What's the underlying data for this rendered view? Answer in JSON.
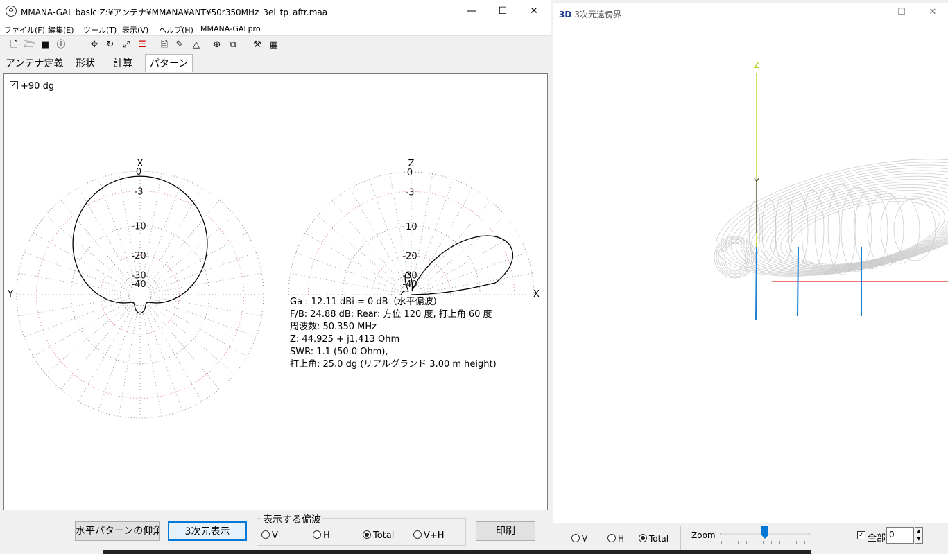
{
  "main_window": {
    "title": "MMANA-GAL basic Z:¥アンテナ¥MMANA¥ANT¥50r350MHz_3el_tp_aftr.maa",
    "controls": {
      "minimize": "—",
      "maximize": "☐",
      "close": "✕"
    },
    "menu": [
      "ファイル(F)",
      "編集(E)",
      "ツール(T)",
      "表示(V)",
      "ヘルプ(H)",
      "MMANA-GALpro"
    ],
    "toolbar_icons": [
      "new-file-icon",
      "open-folder-icon",
      "save-icon",
      "info-icon",
      "move-icon",
      "rotate-icon",
      "scale-icon",
      "wire-icon",
      "document-icon",
      "pen-icon",
      "triangle-icon",
      "target-icon",
      "copy-icon",
      "tools-icon",
      "calculator-icon"
    ],
    "tabs": [
      "アンテナ定義",
      "形状",
      "計算",
      "パターン"
    ],
    "active_tab": "パターン",
    "plus90": {
      "checked": true,
      "label": "+90 dg"
    },
    "horizontal_plot": {
      "top_axis_label": "X",
      "side_axis_label": "Y",
      "rings": [
        "0",
        "-3",
        "-10",
        "-20",
        "-30",
        "-40"
      ]
    },
    "vertical_plot": {
      "top_axis_label": "Z",
      "side_axis_label": "X",
      "rings": [
        "0",
        "-3",
        "-10",
        "-20",
        "-30",
        "-40"
      ]
    },
    "info_lines": [
      "Ga : 12.11 dBi = 0 dB（水平偏波）",
      "F/B: 24.88 dB; Rear: 方位 120 度, 打上角 60 度",
      "周波数: 50.350 MHz",
      "Z: 44.925 + j1.413 Ohm",
      "SWR: 1.1 (50.0 Ohm),",
      "打上角: 25.0 dg (リアルグランド  3.00 m height)"
    ],
    "bottom": {
      "elevation_button": "水平パターンの仰角",
      "three_d_button": "3次元表示",
      "polarization_group": "表示する偏波",
      "polarization_options": [
        "V",
        "H",
        "Total",
        "V+H"
      ],
      "polarization_selected": "Total",
      "print_button": "印刷"
    }
  },
  "view3d_window": {
    "badge": "3D",
    "title": "3次元遠傍界",
    "controls": {
      "minimize": "—",
      "maximize": "☐",
      "close": "✕"
    },
    "axis_labels": {
      "z": "Z",
      "y": "Y"
    },
    "polarization_options": [
      "V",
      "H",
      "Total"
    ],
    "polarization_selected": "Total",
    "zoom_label": "Zoom",
    "zoom_level": 0.5,
    "all_checkbox": {
      "checked": true,
      "label": "全部"
    },
    "spin_value": "0"
  },
  "colors": {
    "grid_red": "#e08080",
    "grid_gray": "#888888",
    "z_axis": "#b0c800",
    "x_axis": "#e02020",
    "element_blue": "#1e7fd0",
    "mesh": "#c8c8c8",
    "accent": "#0078d7"
  }
}
